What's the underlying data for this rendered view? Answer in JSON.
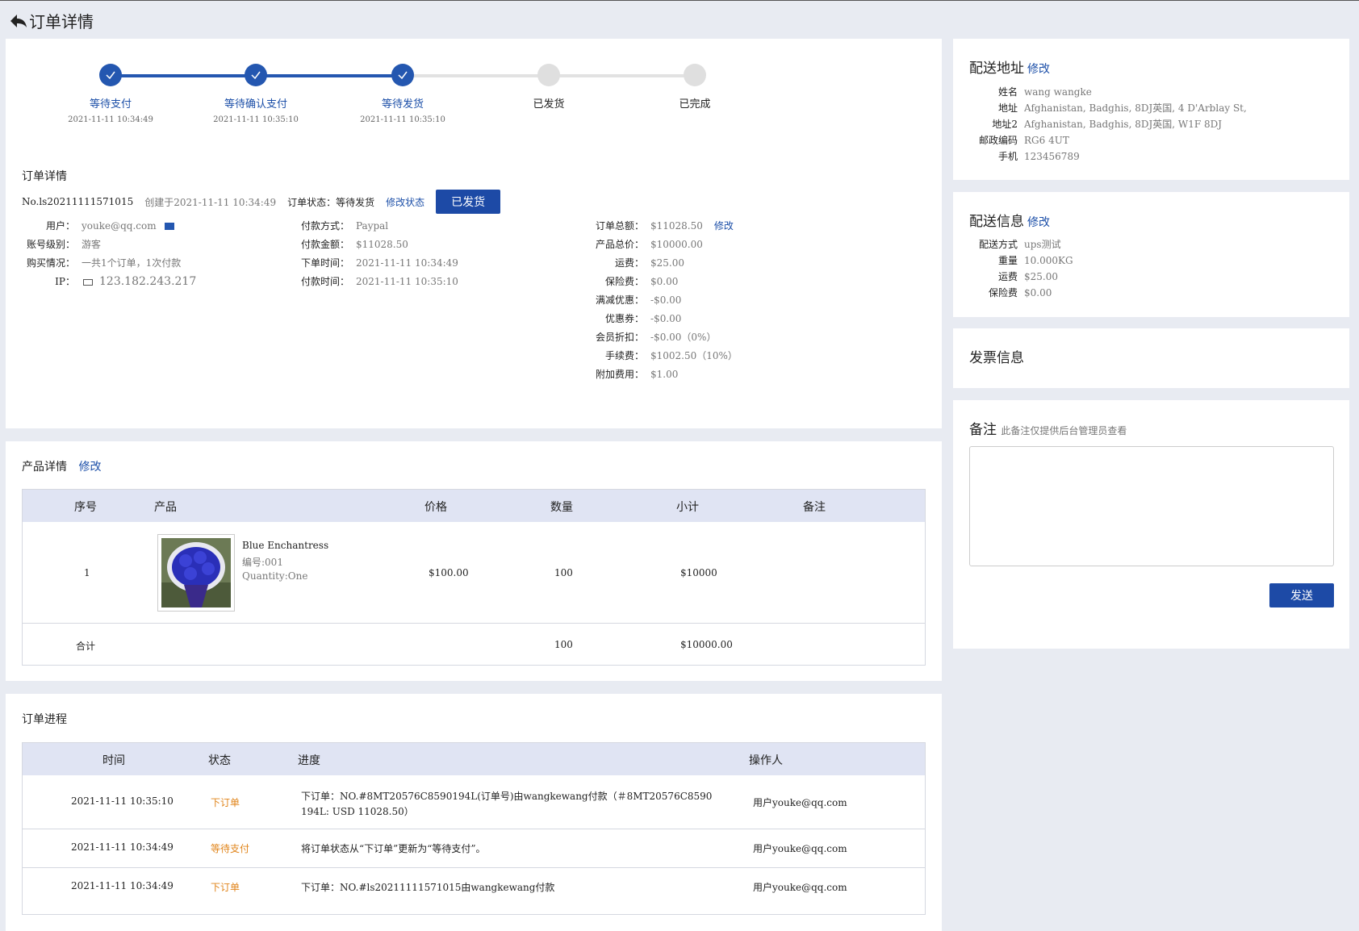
{
  "header": {
    "title": "订单详情"
  },
  "steps": [
    {
      "label": "等待支付",
      "time": "2021-11-11 10:34:49",
      "done": true
    },
    {
      "label": "等待确认支付",
      "time": "2021-11-11 10:35:10",
      "done": true
    },
    {
      "label": "等待发货",
      "time": "2021-11-11 10:35:10",
      "done": true
    },
    {
      "label": "已发货",
      "time": "",
      "done": false
    },
    {
      "label": "已完成",
      "time": "",
      "done": false
    }
  ],
  "order": {
    "section_title": "订单详情",
    "number": "No.ls20211111571015",
    "created": "创建于2021-11-11 10:34:49",
    "status_label": "订单状态：",
    "status_value": "等待发货",
    "change_status": "修改状态",
    "ship_button": "已发货",
    "col1": [
      {
        "k": "用户：",
        "v": "youke@qq.com"
      },
      {
        "k": "账号级别：",
        "v": "游客"
      },
      {
        "k": "购买情况：",
        "v": "一共1个订单，1次付款"
      },
      {
        "k": "IP：",
        "v": "123.182.243.217"
      }
    ],
    "col2": [
      {
        "k": "付款方式：",
        "v": "Paypal"
      },
      {
        "k": "付款金额：",
        "v": "$11028.50"
      },
      {
        "k": "下单时间：",
        "v": "2021-11-11 10:34:49"
      },
      {
        "k": "付款时间：",
        "v": "2021-11-11 10:35:10"
      }
    ],
    "col3": [
      {
        "k": "订单总额：",
        "v": "$11028.50"
      },
      {
        "k": "产品总价：",
        "v": "$10000.00"
      },
      {
        "k": "运费：",
        "v": "$25.00"
      },
      {
        "k": "保险费：",
        "v": "$0.00"
      },
      {
        "k": "满减优惠：",
        "v": "-$0.00"
      },
      {
        "k": "优惠券：",
        "v": "-$0.00"
      },
      {
        "k": "会员折扣：",
        "v": "-$0.00（0%）"
      },
      {
        "k": "手续费：",
        "v": "$1002.50（10%）"
      },
      {
        "k": "附加费用：",
        "v": "$1.00"
      }
    ],
    "total_edit": "修改"
  },
  "products": {
    "title": "产品详情",
    "edit": "修改",
    "headers": [
      "序号",
      "产品",
      "价格",
      "数量",
      "小计",
      "备注"
    ],
    "row": {
      "index": "1",
      "name": "Blue Enchantress",
      "sku": "编号:001",
      "option": "Quantity:One",
      "price": "$100.00",
      "qty": "100",
      "subtotal": "$10000",
      "note": ""
    },
    "total": {
      "label": "合计",
      "qty": "100",
      "subtotal": "$10000.00"
    }
  },
  "progress": {
    "title": "订单进程",
    "headers": [
      "时间",
      "状态",
      "进度",
      "操作人"
    ],
    "rows": [
      {
        "time": "2021-11-11 10:35:10",
        "status": "下订单",
        "desc": "下订单：NO.#8MT20576C8590194L(订单号)由wangkewang付款（＃8MT20576C8590194L: USD 11028.50）",
        "operator": "用户youke@qq.com"
      },
      {
        "time": "2021-11-11 10:34:49",
        "status": "等待支付",
        "desc": "将订单状态从“下订单”更新为“等待支付”。",
        "operator": "用户youke@qq.com"
      },
      {
        "time": "2021-11-11 10:34:49",
        "status": "下订单",
        "desc": "下订单：NO.#ls20211111571015由wangkewang付款",
        "operator": "用户youke@qq.com"
      }
    ]
  },
  "address": {
    "title": "配送地址",
    "edit": "修改",
    "fields": [
      {
        "k": "姓名",
        "v": "wang wangke"
      },
      {
        "k": "地址",
        "v": "Afghanistan, Badghis, 8DJ英国, 4 D'Arblay St,"
      },
      {
        "k": "地址2",
        "v": "Afghanistan, Badghis, 8DJ英国, W1F 8DJ"
      },
      {
        "k": "邮政编码",
        "v": "RG6 4UT"
      },
      {
        "k": "手机",
        "v": "123456789"
      }
    ]
  },
  "shipping": {
    "title": "配送信息",
    "edit": "修改",
    "fields": [
      {
        "k": "配送方式",
        "v": "ups测试"
      },
      {
        "k": "重量",
        "v": "10.000KG"
      },
      {
        "k": "运费",
        "v": "$25.00"
      },
      {
        "k": "保险费",
        "v": "$0.00"
      }
    ]
  },
  "invoice": {
    "title": "发票信息"
  },
  "remark": {
    "title": "备注",
    "hint": "此备注仅提供后台管理员查看",
    "value": "",
    "send": "发送"
  }
}
